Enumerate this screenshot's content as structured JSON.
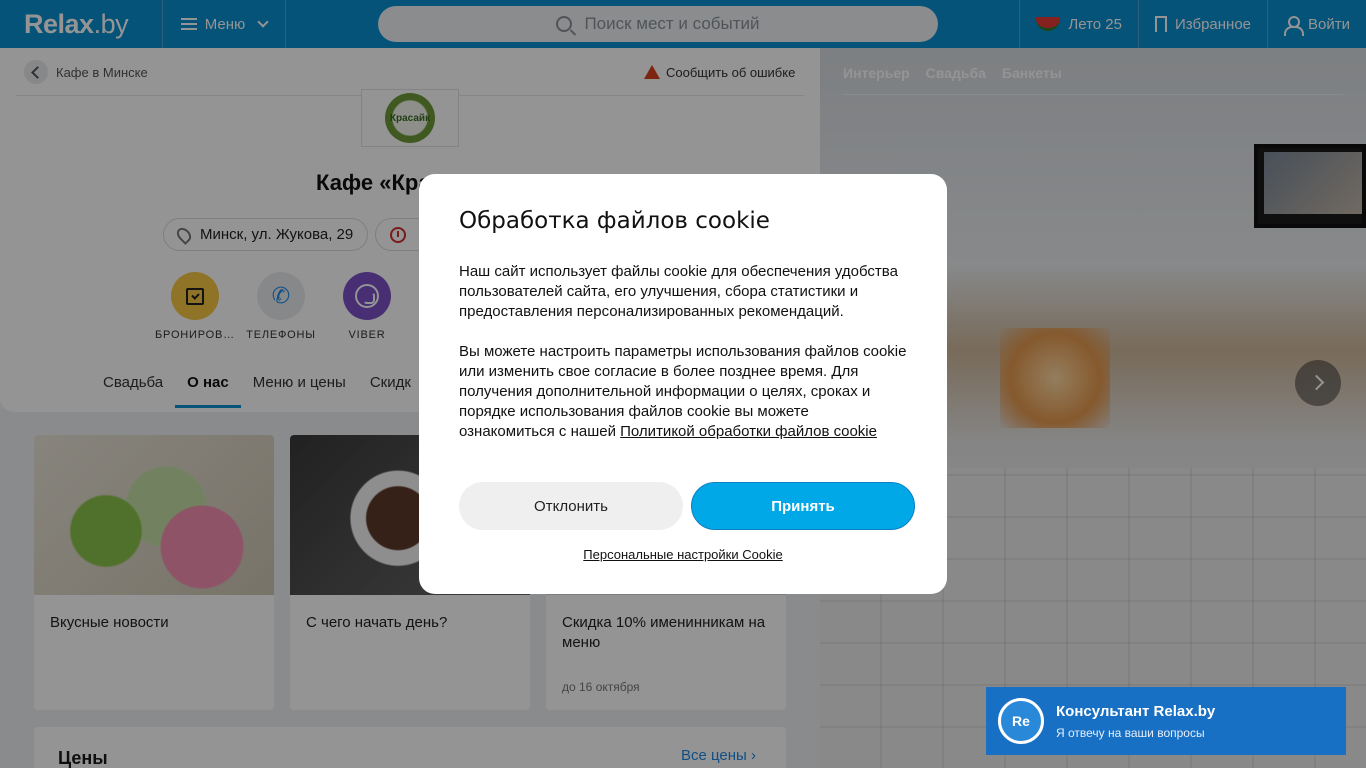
{
  "header": {
    "logo_main": "Relax",
    "logo_suffix": ".by",
    "menu_label": "Меню",
    "search_placeholder": "Поиск мест и событий",
    "summer_label": "Лето 25",
    "favorites_label": "Избранное",
    "login_label": "Войти"
  },
  "page": {
    "breadcrumb": "Кафе в Минске",
    "report_error": "Сообщить об ошибке",
    "logo_text": "Красайк",
    "title": "Кафе «Кра",
    "address": "Минск, ул. Жукова, 29",
    "actions": [
      {
        "label": "БРОНИРОВ…"
      },
      {
        "label": "ТЕЛЕФОНЫ"
      },
      {
        "label": "VIBER"
      }
    ],
    "tabs": [
      {
        "label": "Свадьба"
      },
      {
        "label": "О нас"
      },
      {
        "label": "Меню и цены"
      },
      {
        "label": "Скидк"
      }
    ]
  },
  "news": [
    {
      "title": "Вкусные новости",
      "date": ""
    },
    {
      "title": "С чего начать день?",
      "date": ""
    },
    {
      "title": "Скидка 10% именинникам на меню",
      "date": "до 16 октября"
    }
  ],
  "prices": {
    "title": "Цены",
    "all_link": "Все цены"
  },
  "photo_tabs": [
    {
      "label": "Интерьер"
    },
    {
      "label": "Свадьба"
    },
    {
      "label": "Банкеты"
    }
  ],
  "cookie_dialog": {
    "title": "Обработка файлов cookie",
    "para1": "Наш сайт использует файлы cookie для обеспечения удобства пользователей сайта, его улучшения, сбора статистики и предоставления персонализированных рекомендаций.",
    "para2": "Вы можете настроить параметры использования файлов cookie или изменить свое согласие в более позднее время. Для получения дополнительной информации о целях, сроках и порядке использования файлов cookie вы можете ознакомиться с нашей",
    "policy_link": "Политикой обработки файлов cookie",
    "decline": "Отклонить",
    "accept": "Принять",
    "personal_settings": "Персональные настройки Cookie"
  },
  "consultant": {
    "avatar": "Re",
    "title": "Консультант Relax.by",
    "subtitle": "Я отвечу на ваши вопросы"
  },
  "colors": {
    "header": "#0a8fd0",
    "accept": "#00a8e8",
    "consultant": "#1870c4"
  }
}
